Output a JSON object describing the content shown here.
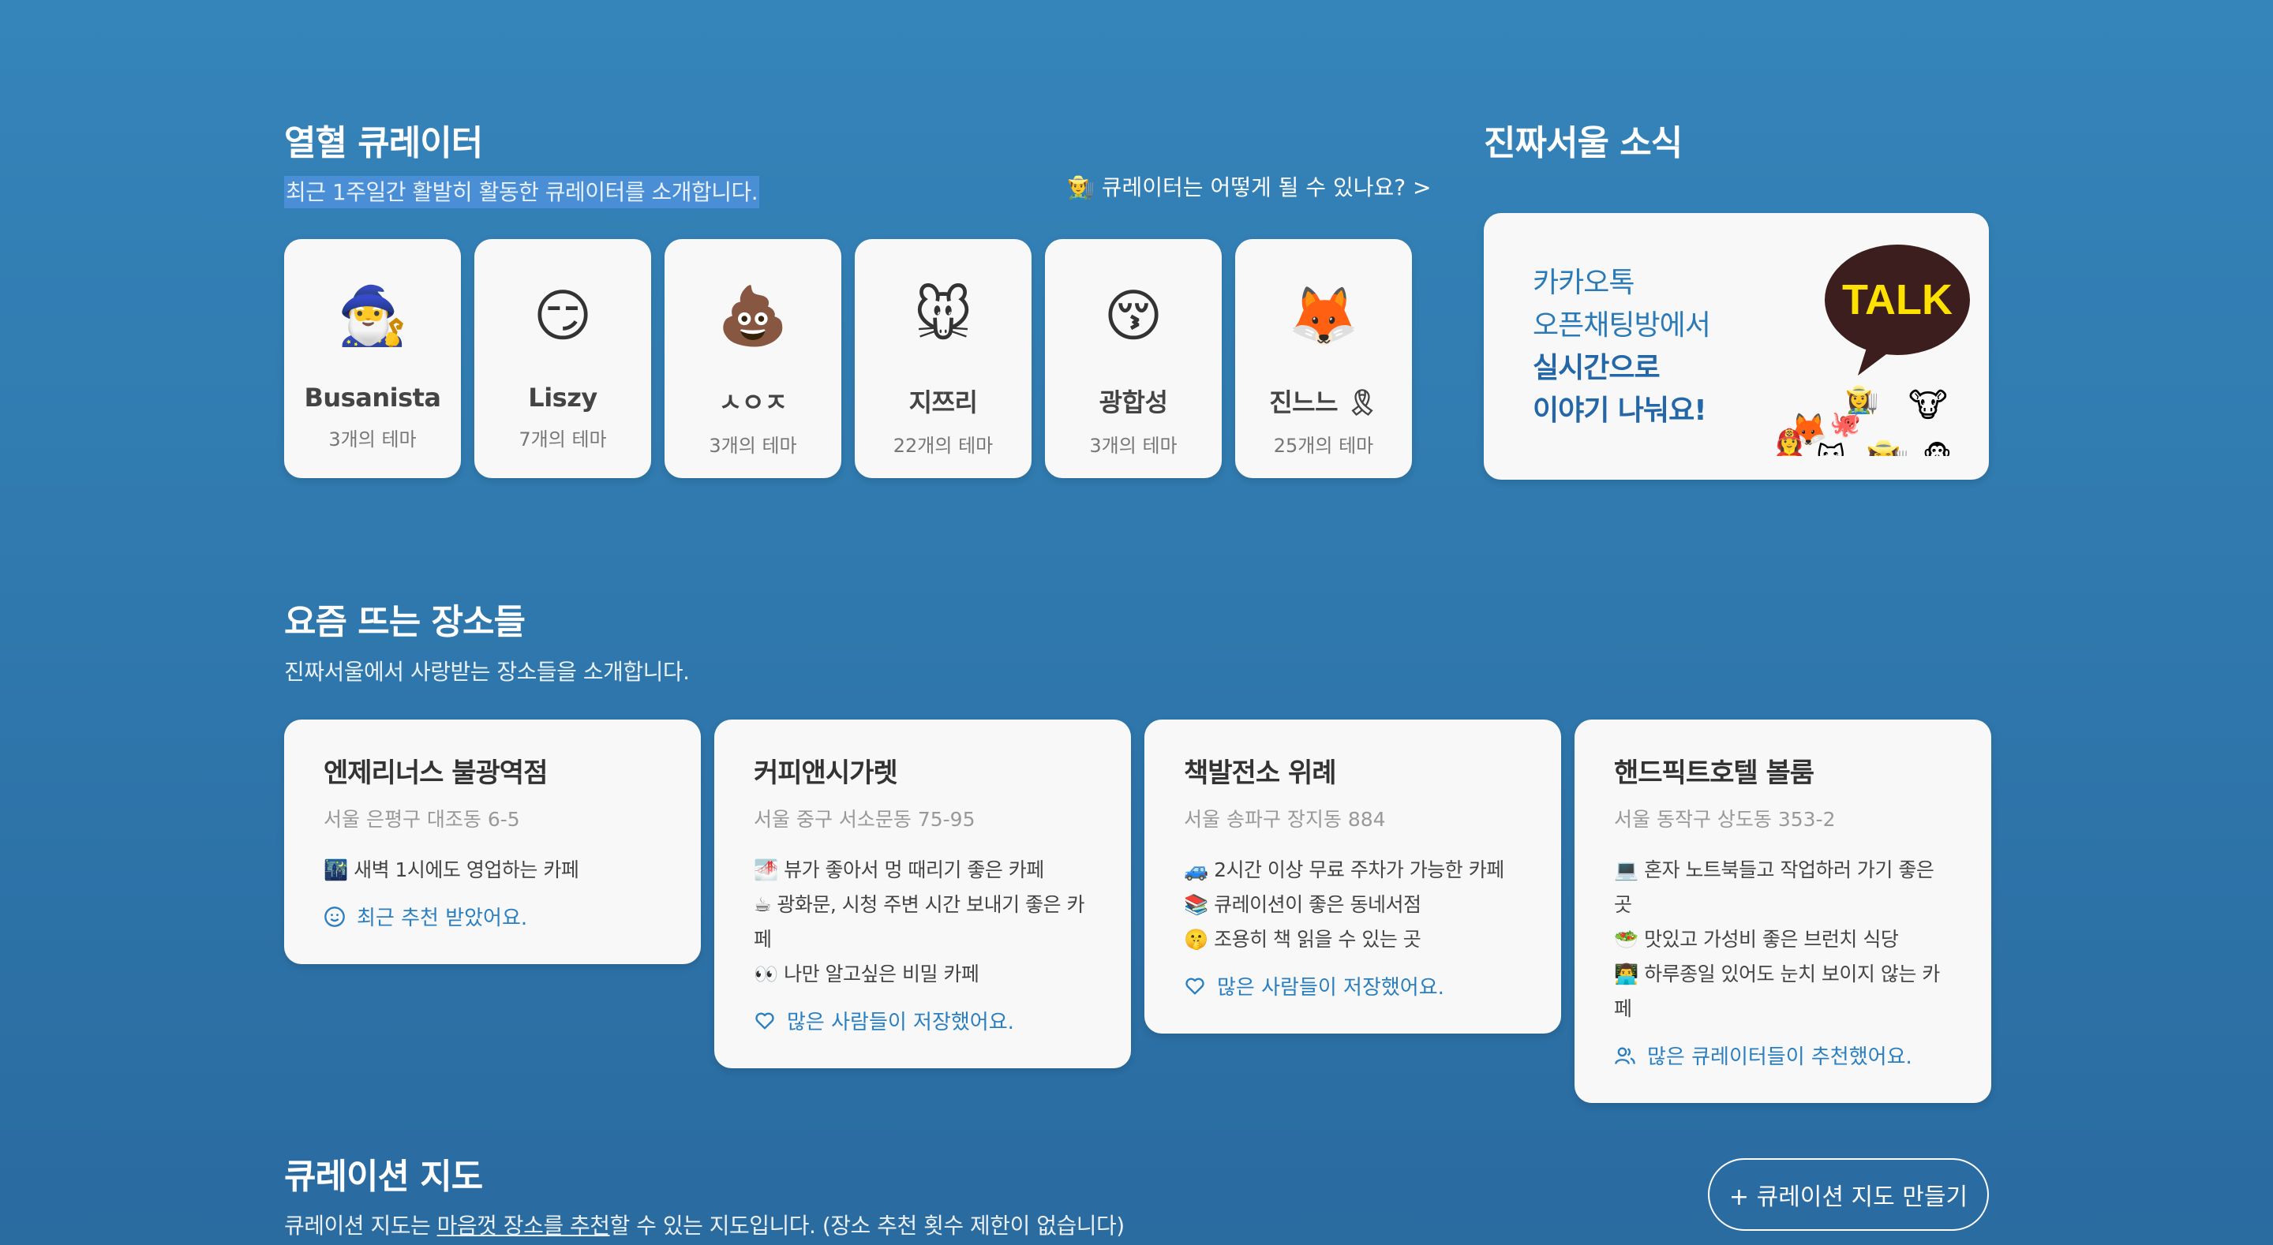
{
  "curators_section": {
    "title": "열혈 큐레이터",
    "subtitle": "최근 1주일간 활발히 활동한 큐레이터를 소개합니다.",
    "how_link": "👨‍🌾 큐레이터는 어떻게 될 수 있나요? >",
    "items": [
      {
        "emoji": "🧙‍♂️",
        "name": "Busanista",
        "count": "3개의 테마"
      },
      {
        "emoji": "😏",
        "name": "Liszy",
        "count": "7개의 테마"
      },
      {
        "emoji": "💩",
        "name": "ㅅㅇㅈ",
        "count": "3개의 테마"
      },
      {
        "emoji": "🐭",
        "name": "지쯔리",
        "count": "22개의 테마"
      },
      {
        "emoji": "😚",
        "name": "광합성",
        "count": "3개의 테마"
      },
      {
        "emoji": "🦊",
        "name": "진느느 🎗",
        "count": "25개의 테마"
      }
    ]
  },
  "news_section": {
    "title": "진짜서울 소식",
    "line1": "카카오톡",
    "line2": "오픈채팅방에서",
    "line3": "실시간으로",
    "line4": "이야기 나눠요!",
    "talk_label": "TALK"
  },
  "places_section": {
    "title": "요즘 뜨는 장소들",
    "subtitle": "진짜서울에서 사랑받는 장소들을 소개합니다.",
    "items": [
      {
        "name": "엔제리너스 불광역점",
        "address": "서울 은평구 대조동 6-5",
        "tags": [
          "🌃 새벽 1시에도 영업하는 카페"
        ],
        "footer": "최근 추천 받았어요.",
        "footer_icon": "smile-icon"
      },
      {
        "name": "커피앤시가렛",
        "address": "서울 중구 서소문동 75-95",
        "tags": [
          "🌁 뷰가 좋아서 멍 때리기 좋은 카페",
          "☕ 광화문, 시청 주변 시간 보내기 좋은 카페",
          "👀 나만 알고싶은 비밀 카페"
        ],
        "footer": "많은 사람들이 저장했어요.",
        "footer_icon": "heart-icon"
      },
      {
        "name": "책발전소 위례",
        "address": "서울 송파구 장지동 884",
        "tags": [
          "🚙 2시간 이상 무료 주차가 가능한 카페",
          "📚 큐레이션이 좋은 동네서점",
          "🤫 조용히 책 읽을 수 있는 곳"
        ],
        "footer": "많은 사람들이 저장했어요.",
        "footer_icon": "heart-icon"
      },
      {
        "name": "핸드픽트호텔 볼룸",
        "address": "서울 동작구 상도동 353-2",
        "tags": [
          "💻 혼자 노트북들고 작업하러 가기 좋은 곳",
          "🥗 맛있고 가성비 좋은 브런치 식당",
          "👨‍💻 하루종일 있어도 눈치 보이지 않는 카페"
        ],
        "footer": "많은 큐레이터들이 추천했어요.",
        "footer_icon": "users-icon"
      }
    ]
  },
  "map_section": {
    "title": "큐레이션 지도",
    "subtitle_pre": "큐레이션 지도는 ",
    "subtitle_link": "마음껏 장소를 추천",
    "subtitle_post": "할 수 있는 지도입니다. (장소 추천 횟수 제한이 없습니다)",
    "button": "+ 큐레이션 지도 만들기"
  }
}
